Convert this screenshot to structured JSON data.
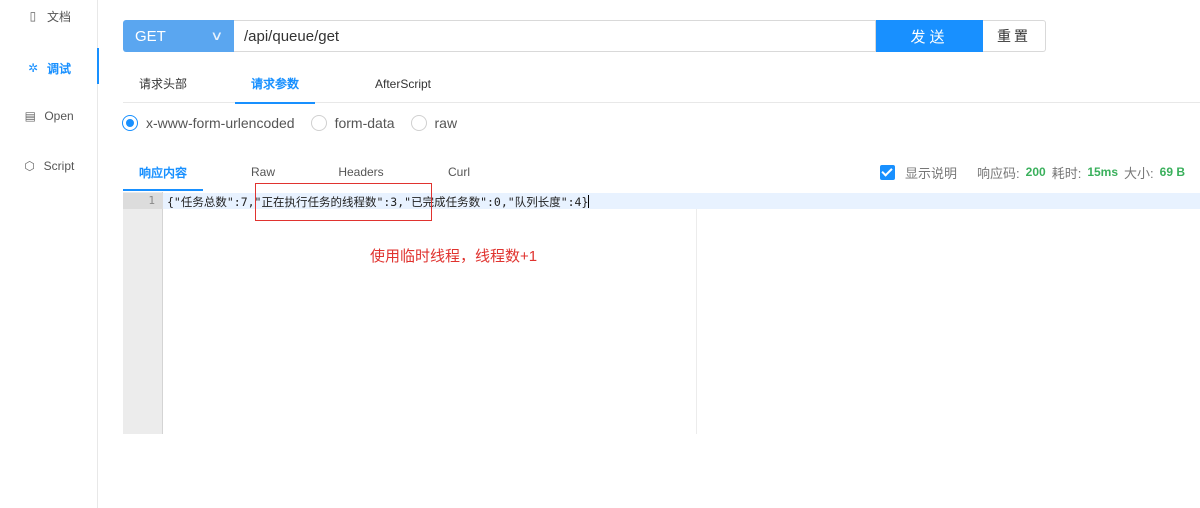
{
  "sidebar": {
    "items": [
      {
        "icon": "document-icon",
        "glyph": "▯",
        "label": "文档"
      },
      {
        "icon": "bug-icon",
        "glyph": "✲",
        "label": "调试"
      },
      {
        "icon": "file-icon",
        "glyph": "▤",
        "label": "Open"
      },
      {
        "icon": "code-icon",
        "glyph": "⬡",
        "label": "Script"
      }
    ]
  },
  "request": {
    "method": "GET",
    "url": "/api/queue/get",
    "send_label": "发送",
    "reset_label": "重置"
  },
  "request_tabs": [
    {
      "label": "请求头部",
      "active": false
    },
    {
      "label": "请求参数",
      "active": true
    },
    {
      "label": "AfterScript",
      "active": false
    }
  ],
  "body_types": [
    {
      "label": "x-www-form-urlencoded",
      "checked": true
    },
    {
      "label": "form-data",
      "checked": false
    },
    {
      "label": "raw",
      "checked": false
    }
  ],
  "response_tabs": [
    {
      "label": "响应内容",
      "active": true
    },
    {
      "label": "Raw",
      "active": false
    },
    {
      "label": "Headers",
      "active": false
    },
    {
      "label": "Curl",
      "active": false
    }
  ],
  "response_meta": {
    "show_desc_label": "显示说明",
    "show_desc_checked": true,
    "status_label": "响应码:",
    "status_value": "200",
    "time_label": "耗时:",
    "time_value": "15ms",
    "size_label": "大小:",
    "size_value": "69 B"
  },
  "editor": {
    "line_number": "1",
    "code": "{\"任务总数\":7,\"正在执行任务的线程数\":3,\"已完成任务数\":0,\"队列长度\":4}"
  },
  "annotation": {
    "text": "使用临时线程，线程数+1",
    "color": "#e0332f"
  },
  "colors": {
    "accent": "#1890ff",
    "method_bg": "#5aa6f0",
    "meta_value": "#3ab05c"
  }
}
